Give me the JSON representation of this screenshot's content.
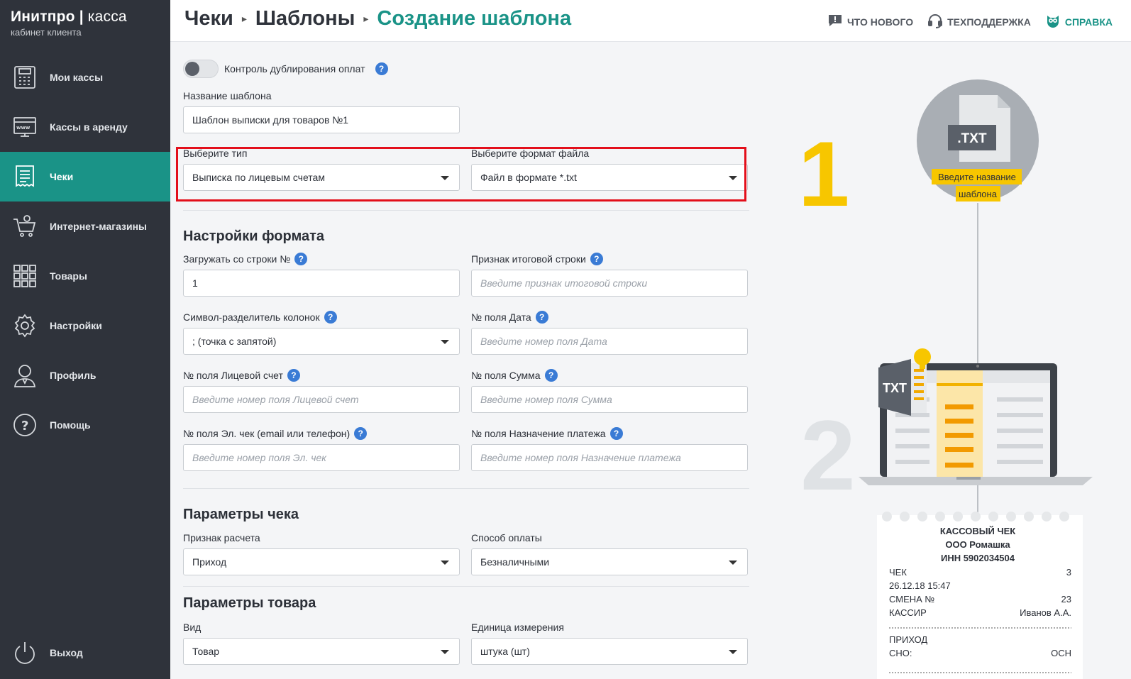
{
  "brand": {
    "name": "Инитпро",
    "product": "касса",
    "subtitle": "кабинет клиента"
  },
  "sidebar": {
    "items": [
      {
        "label": "Мои кассы",
        "icon": "cash-register-icon"
      },
      {
        "label": "Кассы в аренду",
        "icon": "www-terminal-icon"
      },
      {
        "label": "Чеки",
        "icon": "receipt-icon",
        "active": true
      },
      {
        "label": "Интернет-магазины",
        "icon": "shopping-cart-icon"
      },
      {
        "label": "Товары",
        "icon": "grid-icon"
      },
      {
        "label": "Настройки",
        "icon": "gear-icon"
      },
      {
        "label": "Профиль",
        "icon": "user-icon"
      },
      {
        "label": "Помощь",
        "icon": "question-icon"
      }
    ],
    "logout": "Выход"
  },
  "header": {
    "crumbs": [
      "Чеки",
      "Шаблоны",
      "Создание шаблона"
    ],
    "links": {
      "news": "ЧТО НОВОГО",
      "support": "ТЕХПОДДЕРЖКА",
      "help": "СПРАВКА"
    }
  },
  "form": {
    "dup_control": "Контроль дублирования оплат",
    "name_label": "Название шаблона",
    "name_value": "Шаблон выписки для товаров №1",
    "type_label": "Выберите тип",
    "type_value": "Выписка по лицевым счетам",
    "format_label": "Выберите формат файла",
    "format_value": "Файл в формате *.txt",
    "format_section": "Настройки формата",
    "start_row_label": "Загружать со строки №",
    "start_row_value": "1",
    "total_label": "Признак итоговой строки",
    "total_ph": "Введите признак итоговой строки",
    "sep_label": "Символ-разделитель колонок",
    "sep_value": "; (точка с запятой)",
    "date_label": "№ поля Дата",
    "date_ph": "Введите номер поля Дата",
    "account_label": "№ поля Лицевой счет",
    "account_ph": "Введите номер поля Лицевой счет",
    "sum_label": "№ поля Сумма",
    "sum_ph": "Введите номер поля Сумма",
    "echeck_label": "№ поля Эл. чек (email или телефон)",
    "echeck_ph": "Введите номер поля Эл. чек",
    "purpose_label": "№ поля Назначение платежа",
    "purpose_ph": "Введите номер поля Назначение платежа",
    "check_section": "Параметры чека",
    "calc_label": "Признак расчета",
    "calc_value": "Приход",
    "pay_label": "Способ оплаты",
    "pay_value": "Безналичными",
    "goods_section": "Параметры товара",
    "kind_label": "Вид",
    "kind_value": "Товар",
    "unit_label": "Единица измерения",
    "unit_value": "штука (шт)"
  },
  "illustration": {
    "step1": "1",
    "step2": "2",
    "file_ext": ".TXT",
    "tooltip_line1": "Введите название",
    "tooltip_line2": "шаблона",
    "laptop_badge": "TXT",
    "receipt": {
      "title": "КАССОВЫЙ ЧЕК",
      "org": "ООО Ромашка",
      "inn": "ИНН 5902034504",
      "rows": [
        {
          "k": "ЧЕК",
          "v": "3"
        },
        {
          "k": "26.12.18 15:47",
          "v": ""
        },
        {
          "k": "СМЕНА №",
          "v": "23"
        },
        {
          "k": "КАССИР",
          "v": "Иванов А.А."
        }
      ],
      "rows2": [
        {
          "k": "ПРИХОД",
          "v": ""
        },
        {
          "k": "СНО:",
          "v": "ОСН"
        }
      ]
    }
  },
  "colors": {
    "accent": "#1a9387",
    "sidebar": "#2f333b",
    "highlight": "#e30f1b",
    "step": "#f7c600"
  }
}
